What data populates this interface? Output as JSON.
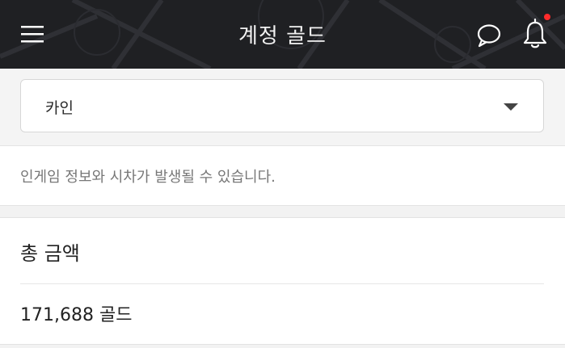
{
  "header": {
    "title": "계정 골드",
    "menu_icon": "hamburger-menu-icon",
    "chat_icon": "chat-bubble-icon",
    "bell_icon": "bell-icon",
    "has_notification": true,
    "background_color": "#1f2023",
    "notification_color": "#ff2b2b"
  },
  "character_select": {
    "selected": "카인"
  },
  "notice": {
    "text": "인게임 정보와 시차가 발생될 수 있습니다."
  },
  "total": {
    "label": "총 금액",
    "value": "171,688 골드"
  }
}
